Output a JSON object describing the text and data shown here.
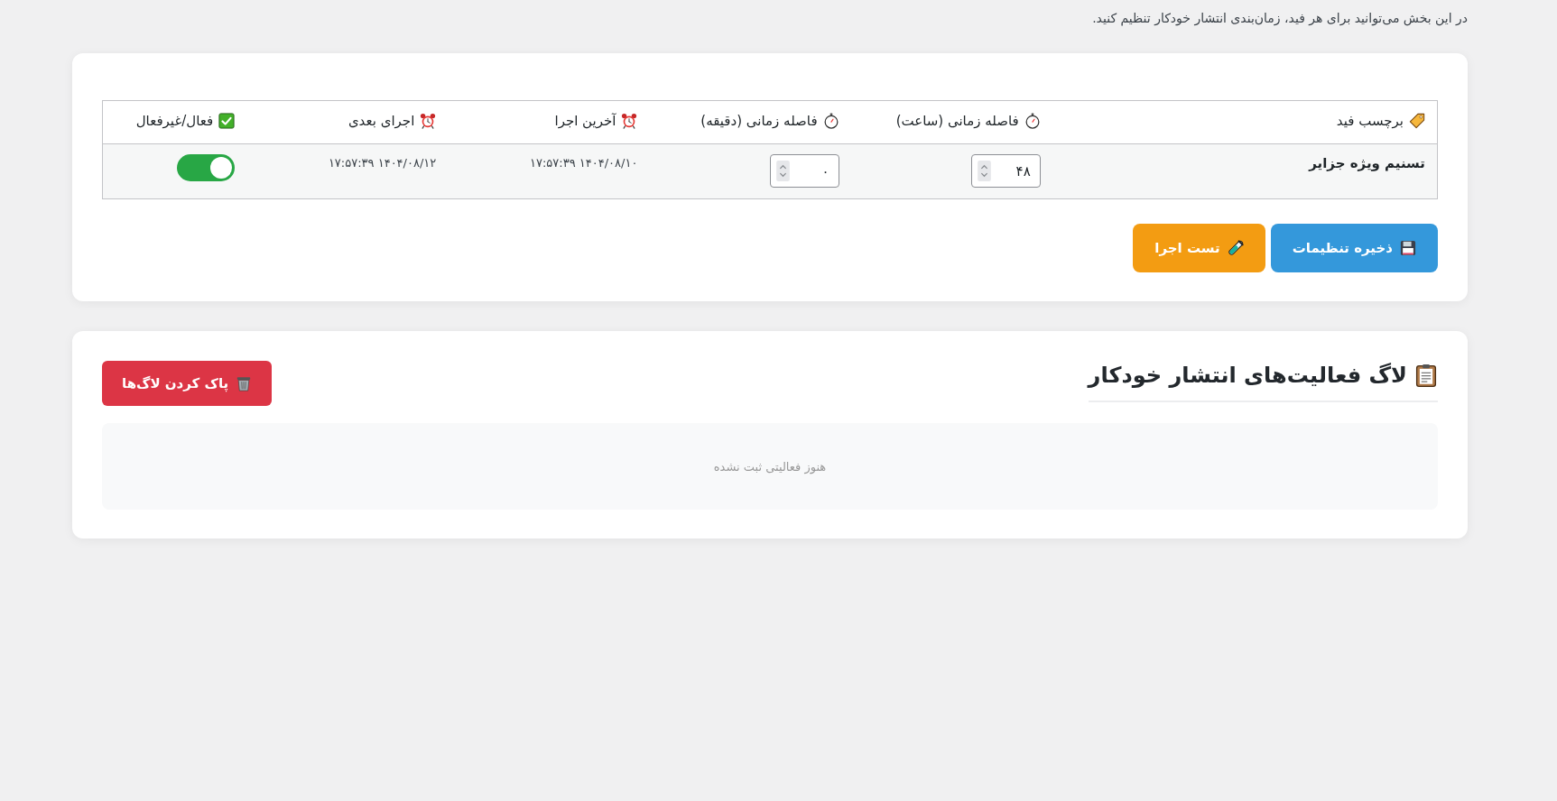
{
  "intro": "در این بخش می‌توانید برای هر فید، زمان‌بندی انتشار خودکار تنظیم کنید.",
  "schedule_table": {
    "columns": [
      {
        "label": "برچسب فید",
        "kind": "text"
      },
      {
        "label": "فاصله زمانی (ساعت)",
        "kind": "number"
      },
      {
        "label": "فاصله زمانی (دقیقه)",
        "kind": "number"
      },
      {
        "label": "آخرین اجرا",
        "kind": "datetime"
      },
      {
        "label": "اجرای بعدی",
        "kind": "datetime"
      },
      {
        "label": "فعال/غیرفعال",
        "kind": "switch"
      }
    ],
    "rows": [
      {
        "cells": [
          {
            "text": "تسنیم ویژه جزایر"
          },
          {
            "value": "۴۸"
          },
          {
            "value": "۰"
          },
          {
            "text": "۱۴۰۴/۰۸/۱۰ ۱۷:۵۷:۳۹"
          },
          {
            "text": "۱۴۰۴/۰۸/۱۲ ۱۷:۵۷:۳۹"
          },
          {
            "on": true
          }
        ]
      }
    ]
  },
  "buttons": [
    {
      "label": "ذخیره تنظیمات",
      "kind": "primary"
    },
    {
      "label": "تست اجرا",
      "kind": "warning"
    }
  ],
  "log": {
    "title": "لاگ فعالیت‌های انتشار خودکار",
    "clear_button": "پاک کردن لاگ‌ها",
    "empty_message": "هنوز فعالیتی ثبت نشده"
  }
}
